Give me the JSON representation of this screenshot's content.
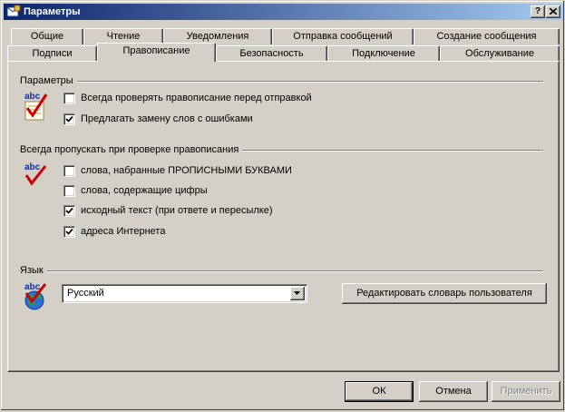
{
  "window": {
    "title": "Параметры",
    "help_label": "?",
    "close_label": "✕"
  },
  "tabs_back": [
    "Общие",
    "Чтение",
    "Уведомления",
    "Отправка сообщений",
    "Создание сообщения"
  ],
  "tabs_front": [
    "Подписи",
    "Правописание",
    "Безопасность",
    "Подключение",
    "Обслуживание"
  ],
  "active_tab": "Правописание",
  "settings": {
    "label": "Параметры",
    "items": [
      {
        "label": "Всегда проверять правописание перед отправкой",
        "checked": false
      },
      {
        "label": "Предлагать замену слов с ошибками",
        "checked": true
      }
    ]
  },
  "ignore": {
    "label": "Всегда пропускать при проверке правописания",
    "items": [
      {
        "label": "слова, набранные ПРОПИСНЫМИ БУКВАМИ",
        "checked": false
      },
      {
        "label": "слова, содержащие цифры",
        "checked": false
      },
      {
        "label": "исходный текст (при ответе и пересылке)",
        "checked": true
      },
      {
        "label": "адреса Интернета",
        "checked": true
      }
    ]
  },
  "language": {
    "label": "Язык",
    "selected": "Русский",
    "edit_dictionary_label": "Редактировать словарь пользователя"
  },
  "footer": {
    "ok_label": "ОК",
    "cancel_label": "Отмена",
    "apply_label": "Применить"
  },
  "icons": {
    "spell_text": "abc",
    "check_color": "#d00000",
    "globe_color": "#2a6fd6"
  }
}
